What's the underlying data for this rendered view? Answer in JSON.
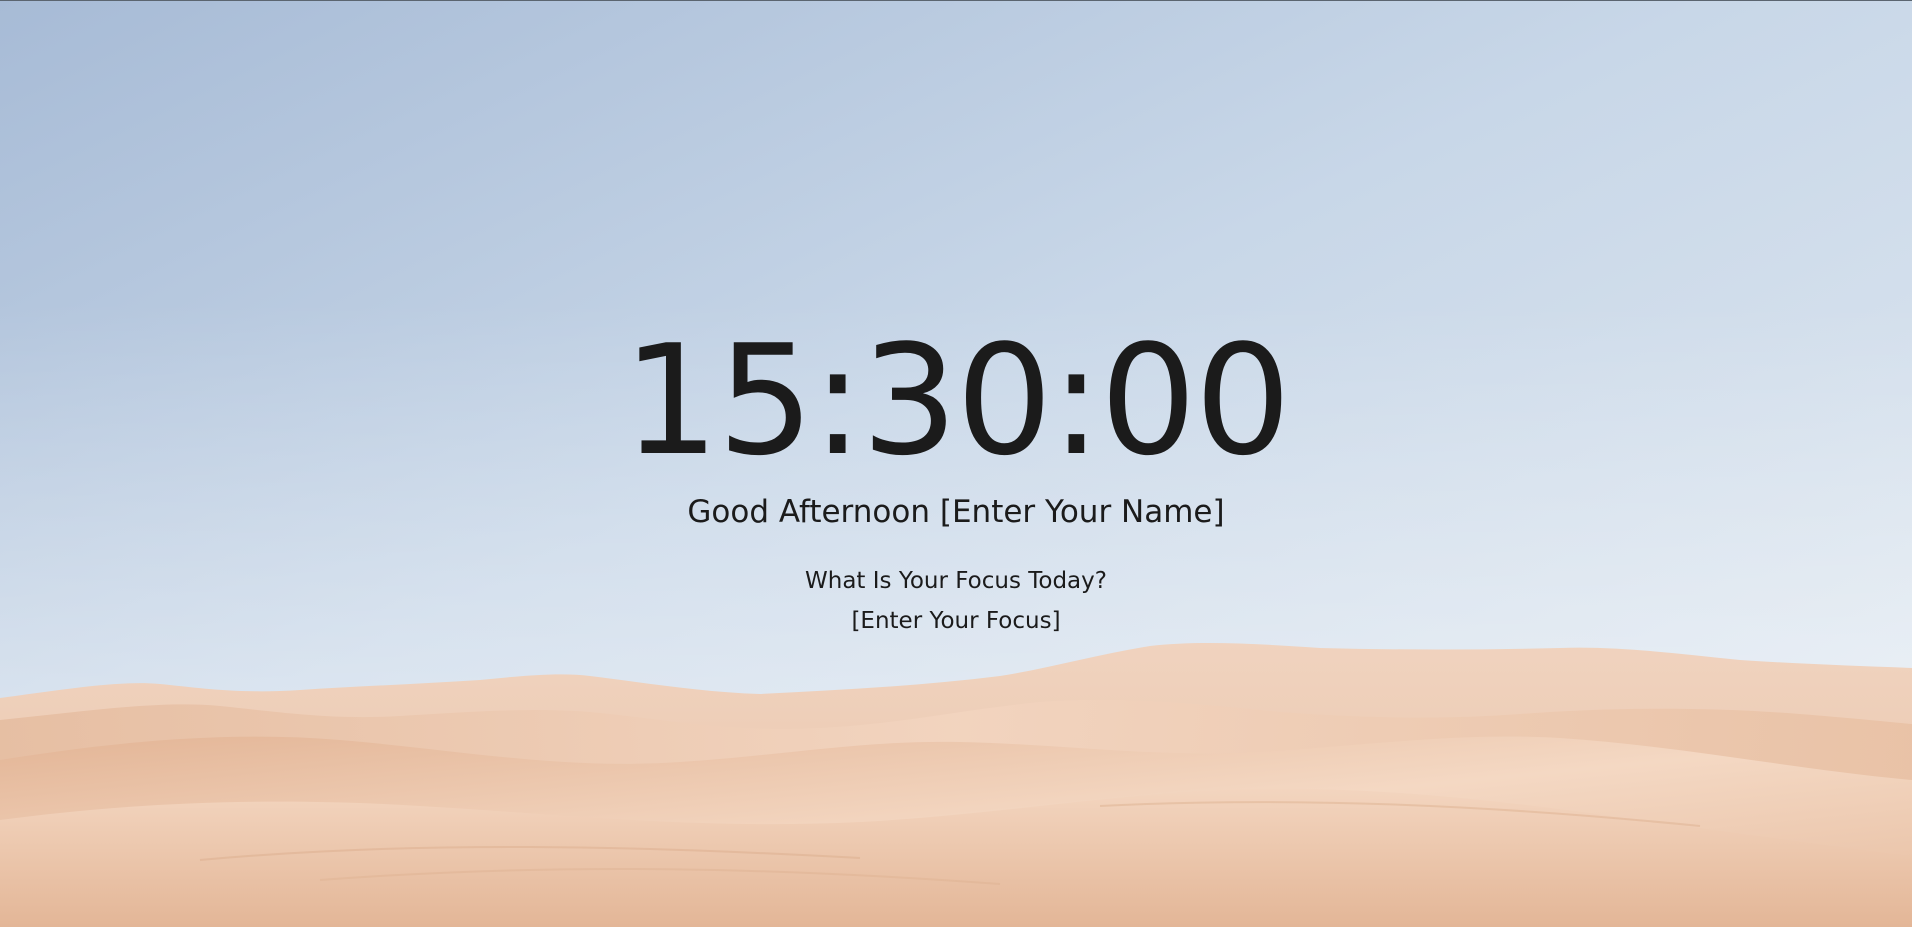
{
  "clock": {
    "time": "15:30:00"
  },
  "greeting": {
    "text": "Good Afternoon",
    "name": "[Enter Your Name]"
  },
  "focus": {
    "question": "What Is Your Focus Today?",
    "value": "[Enter Your Focus]"
  },
  "background": {
    "image": "desert-dunes-photo",
    "sky_top": "#a9bcd6",
    "sky_bottom": "#dfe8f1",
    "sand_light": "#f3d6c0",
    "sand_dark": "#dfb497"
  }
}
